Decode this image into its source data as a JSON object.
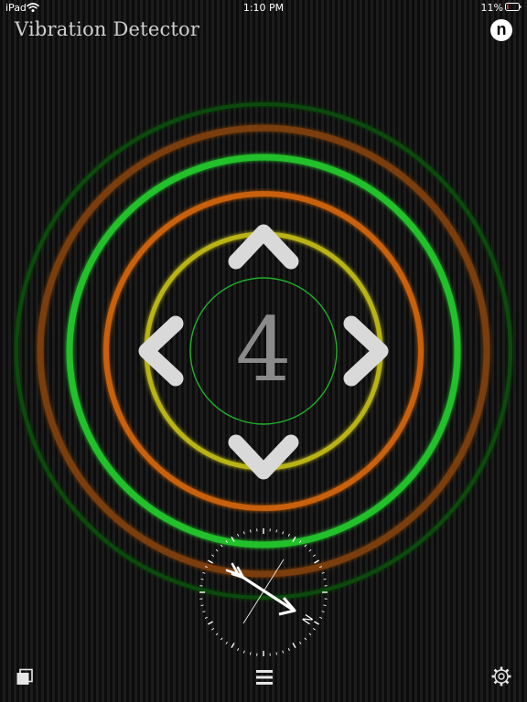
{
  "status_bar": {
    "device": "iPad",
    "time": "1:10 PM",
    "battery": "11%"
  },
  "header": {
    "title": "Vibration Detector",
    "n_button_label": "n"
  },
  "detector": {
    "level": "4"
  },
  "colors": {
    "ring_green": "#22c02a",
    "ring_orange": "#c8600f",
    "ring_yellow": "#b9b313",
    "arrow_gray": "#d9d9d9",
    "level_gray": "#8a8a8a"
  },
  "compass": {
    "north_label": "N"
  },
  "icons": {
    "wifi": "wifi-icon",
    "battery": "battery-icon",
    "up": "chevron-up-icon",
    "down": "chevron-down-icon",
    "left": "chevron-left-icon",
    "right": "chevron-right-icon",
    "compass": "compass-icon",
    "windows": "windows-icon",
    "menu": "menu-icon",
    "settings": "gear-icon"
  }
}
